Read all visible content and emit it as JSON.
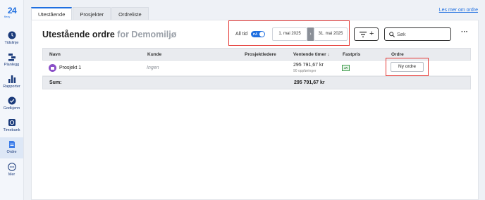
{
  "app": {
    "logo_number": "24",
    "logo_sub": "flexy"
  },
  "sidebar": {
    "items": [
      {
        "label": "Tidslinje",
        "icon": "clock-icon"
      },
      {
        "label": "Planlegg",
        "icon": "plan-icon"
      },
      {
        "label": "Rapporter",
        "icon": "bar-chart-icon"
      },
      {
        "label": "Godkjenn",
        "icon": "check-circle-icon"
      },
      {
        "label": "Timebank",
        "icon": "timebank-icon"
      },
      {
        "label": "Ordre",
        "icon": "document-icon",
        "active": true
      },
      {
        "label": "Mer",
        "icon": "more-circle-icon"
      }
    ]
  },
  "tabs": [
    {
      "label": "Utestående",
      "active": true
    },
    {
      "label": "Prosjekter",
      "active": false
    },
    {
      "label": "Ordreliste",
      "active": false
    }
  ],
  "learn_link": "Les mer om ordre",
  "header": {
    "title": "Utestående ordre",
    "context": "for Demomiljø"
  },
  "period": {
    "all_time_label": "All tid",
    "toggle_label": "PÅ",
    "date_from": "1. mai 2025",
    "date_to": "31. mai 2025"
  },
  "search": {
    "placeholder": "Søk"
  },
  "table": {
    "columns": [
      "Navn",
      "Kunde",
      "Prosjektledere",
      "Ventende timer ↓",
      "Fastpris",
      "Ordre"
    ],
    "rows": [
      {
        "name": "Prosjekt 1",
        "customer": "Ingen",
        "managers": "",
        "pending_hours": "295 791,67 kr",
        "pending_sub": "90 oppføringer",
        "fixed_price": "JA",
        "order_button": "Ny ordre"
      }
    ],
    "sum": {
      "label": "Sum:",
      "pending_hours": "295 791,67 kr"
    }
  },
  "colors": {
    "accent": "#1f6fe0",
    "highlight": "#e53935",
    "project": "#8a4fc7",
    "badge_green": "#3f9d4d"
  }
}
